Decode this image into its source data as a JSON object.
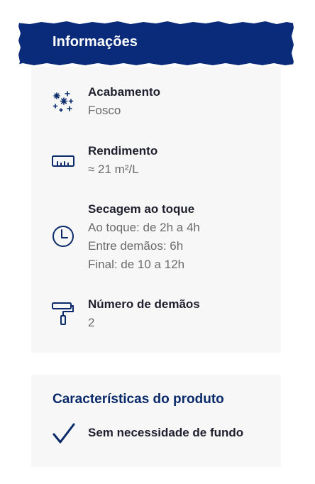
{
  "info": {
    "title": "Informações",
    "items": [
      {
        "icon": "sparkles-icon",
        "label": "Acabamento",
        "values": [
          "Fosco"
        ]
      },
      {
        "icon": "ruler-icon",
        "label": "Rendimento",
        "values": [
          "≈ 21 m²/L"
        ]
      },
      {
        "icon": "clock-icon",
        "label": "Secagem ao toque",
        "values": [
          "Ao toque: de 2h a 4h",
          "Entre demãos: 6h",
          "Final: de 10 a 12h"
        ]
      },
      {
        "icon": "paint-roller-icon",
        "label": "Número de demãos",
        "values": [
          "2"
        ]
      }
    ]
  },
  "characteristics": {
    "title": "Características do produto",
    "items": [
      {
        "icon": "check-icon",
        "label": "Sem necessidade de fundo"
      }
    ]
  },
  "colors": {
    "header_bg": "#0a2a7a",
    "accent": "#0a2a6a",
    "card_bg": "#f7f7f7",
    "label_text": "#1f1f2e",
    "value_text": "#6b6b6b"
  }
}
